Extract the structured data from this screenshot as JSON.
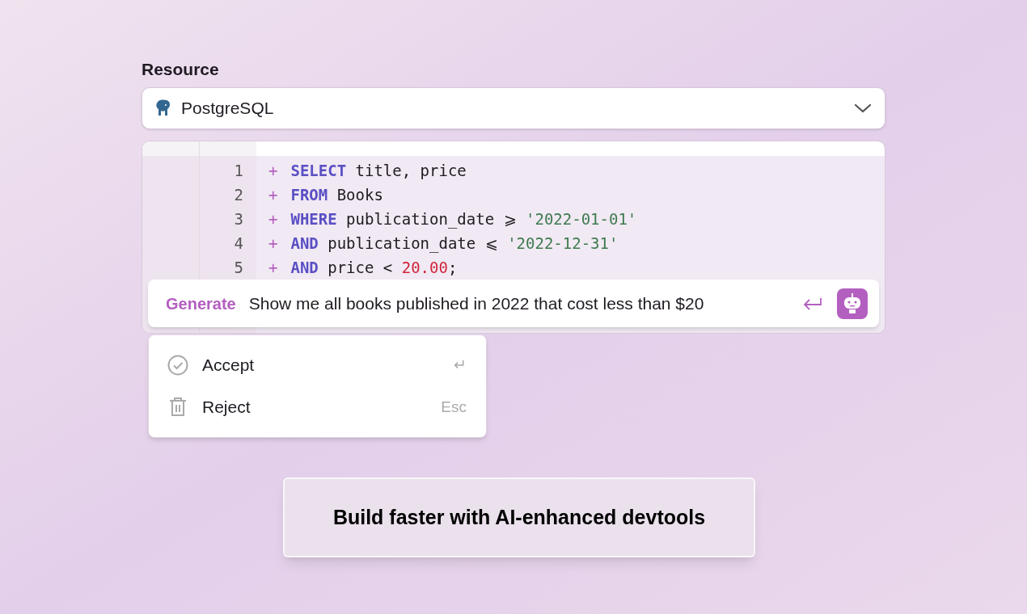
{
  "resource": {
    "label": "Resource",
    "value": "PostgreSQL"
  },
  "editor": {
    "lines": [
      {
        "number": "1",
        "marker": "+",
        "tokens": [
          {
            "kind": "keyword",
            "text": "SELECT"
          },
          {
            "kind": "plain",
            "text": " title, price"
          }
        ]
      },
      {
        "number": "2",
        "marker": "+",
        "tokens": [
          {
            "kind": "keyword",
            "text": "FROM"
          },
          {
            "kind": "plain",
            "text": " Books"
          }
        ]
      },
      {
        "number": "3",
        "marker": "+",
        "tokens": [
          {
            "kind": "keyword",
            "text": "WHERE"
          },
          {
            "kind": "plain",
            "text": " publication_date ⩾ "
          },
          {
            "kind": "string",
            "text": "'2022-01-01'"
          }
        ]
      },
      {
        "number": "4",
        "marker": "+",
        "tokens": [
          {
            "kind": "keyword",
            "text": "AND"
          },
          {
            "kind": "plain",
            "text": " publication_date ⩽ "
          },
          {
            "kind": "string",
            "text": "'2022-12-31'"
          }
        ]
      },
      {
        "number": "5",
        "marker": "+",
        "tokens": [
          {
            "kind": "keyword",
            "text": "AND"
          },
          {
            "kind": "plain",
            "text": " price < "
          },
          {
            "kind": "number",
            "text": "20.00"
          },
          {
            "kind": "plain",
            "text": ";"
          }
        ]
      }
    ]
  },
  "prompt": {
    "label": "Generate",
    "value": "Show me all books published in 2022 that cost less than $20"
  },
  "menu": [
    {
      "kind": "accept",
      "label": "Accept",
      "shortcut": "↵"
    },
    {
      "kind": "reject",
      "label": "Reject",
      "shortcut": "Esc"
    }
  ],
  "banner": "Build faster with AI-enhanced devtools"
}
